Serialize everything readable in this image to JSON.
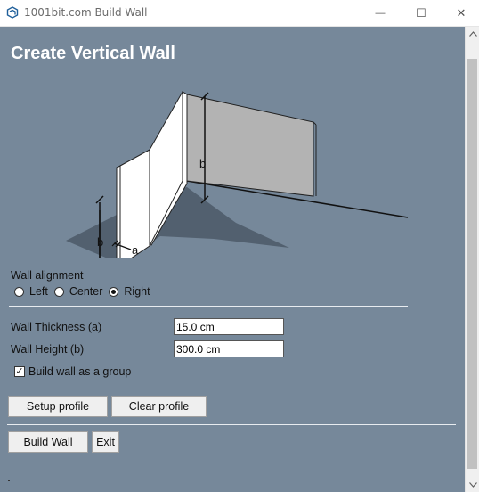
{
  "window": {
    "title": "1001bit.com Build Wall",
    "minimize_glyph": "—",
    "maximize_glyph": "☐",
    "close_glyph": "✕"
  },
  "page": {
    "heading": "Create Vertical Wall"
  },
  "illustration": {
    "label_a": "a",
    "label_b_left": "b",
    "label_b_right": "b"
  },
  "alignment": {
    "label": "Wall alignment",
    "options": [
      {
        "label": "Left",
        "selected": false
      },
      {
        "label": "Center",
        "selected": false
      },
      {
        "label": "Right",
        "selected": true
      }
    ]
  },
  "fields": {
    "thickness_label": "Wall Thickness (a)",
    "thickness_value": "15.0 cm",
    "height_label": "Wall Height (b)",
    "height_value": "300.0 cm"
  },
  "group_option": {
    "label": "Build wall as a group",
    "checked": true,
    "check_glyph": "✓"
  },
  "buttons": {
    "setup_profile": "Setup profile",
    "clear_profile": "Clear profile",
    "build_wall": "Build Wall",
    "exit": "Exit"
  },
  "colors": {
    "background": "#76889a",
    "heading": "#ffffff"
  }
}
